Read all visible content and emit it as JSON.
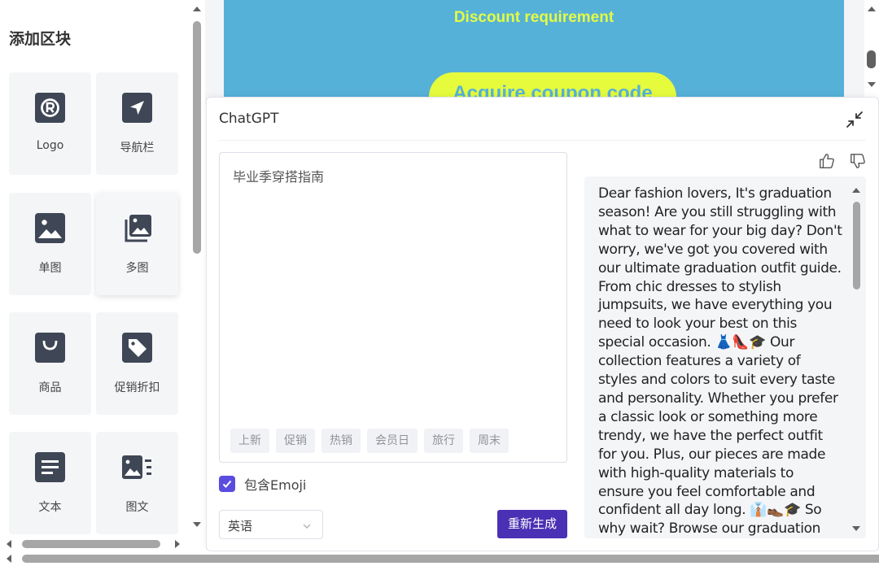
{
  "left_panel": {
    "title": "添加区块",
    "blocks": [
      {
        "label": "Logo",
        "icon": "registered-icon"
      },
      {
        "label": "导航栏",
        "icon": "navigation-arrow-icon"
      },
      {
        "label": "单图",
        "icon": "image-icon"
      },
      {
        "label": "多图",
        "icon": "multi-image-icon"
      },
      {
        "label": "商品",
        "icon": "shopping-bag-icon"
      },
      {
        "label": "促销折扣",
        "icon": "price-tag-icon"
      },
      {
        "label": "文本",
        "icon": "text-icon"
      },
      {
        "label": "图文",
        "icon": "image-text-icon"
      }
    ]
  },
  "preview": {
    "discount_text": "Discount requirement",
    "coupon_button": "Acquire coupon code",
    "banner_color": "#56b1d9",
    "accent_color": "#e5fb3c"
  },
  "chat": {
    "title": "ChatGPT",
    "prompt": "毕业季穿搭指南",
    "tags": [
      "上新",
      "促销",
      "热销",
      "会员日",
      "旅行",
      "周末"
    ],
    "emoji_label": "包含Emoji",
    "emoji_checked": true,
    "language": "英语",
    "regenerate_label": "重新生成",
    "regenerate_color": "#4a30b4",
    "result": "Dear fashion lovers, It's graduation season! Are you still struggling with what to wear for your big day? Don't worry, we've got you covered with our ultimate graduation outfit guide. From chic dresses to stylish jumpsuits, we have everything you need to look your best on this special occasion. 👗👠🎓 Our collection features a variety of styles and colors to suit every taste and personality. Whether you prefer a classic look or something more trendy, we have the perfect outfit for you. Plus, our pieces are made with high-quality materials to ensure you feel comfortable and confident all day long. 👔👞🎓 So why wait? Browse our graduation outfit"
  }
}
